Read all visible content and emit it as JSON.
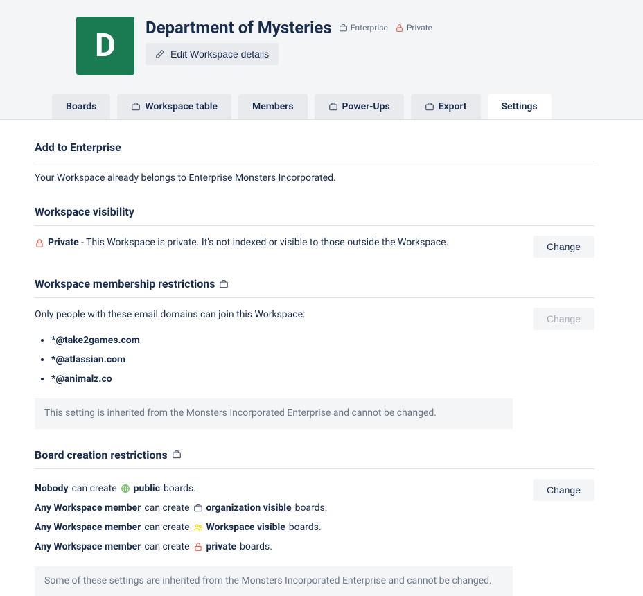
{
  "workspace": {
    "initial": "D",
    "title": "Department of Mysteries",
    "enterprise_badge": "Enterprise",
    "privacy_badge": "Private",
    "edit_label": "Edit Workspace details"
  },
  "tabs": {
    "boards": "Boards",
    "workspace_table": "Workspace table",
    "members": "Members",
    "powerups": "Power-Ups",
    "export": "Export",
    "settings": "Settings"
  },
  "sections": {
    "enterprise": {
      "heading": "Add to Enterprise",
      "text": "Your Workspace already belongs to Enterprise Monsters Incorporated."
    },
    "visibility": {
      "heading": "Workspace visibility",
      "label": "Private",
      "text": " - This Workspace is private. It's not indexed or visible to those outside the Workspace.",
      "change": "Change"
    },
    "membership": {
      "heading": "Workspace membership restrictions",
      "intro": "Only people with these email domains can join this Workspace:",
      "domains": [
        "*@take2games.com",
        "*@atlassian.com",
        "*@animalz.co"
      ],
      "inherited": "This setting is inherited from the Monsters Incorporated Enterprise and cannot be changed.",
      "change": "Change"
    },
    "board_creation": {
      "heading": "Board creation restrictions",
      "change": "Change",
      "rules": [
        {
          "who": "Nobody",
          "verb": " can create ",
          "scope": "public",
          "suffix": " boards.",
          "icon": "globe"
        },
        {
          "who": "Any Workspace member",
          "verb": " can create ",
          "scope": "organization visible",
          "suffix": " boards.",
          "icon": "briefcase"
        },
        {
          "who": "Any Workspace member",
          "verb": " can create ",
          "scope": "Workspace visible",
          "suffix": " boards.",
          "icon": "people"
        },
        {
          "who": "Any Workspace member",
          "verb": " can create ",
          "scope": "private",
          "suffix": " boards.",
          "icon": "lock"
        }
      ],
      "inherited": "Some of these settings are inherited from the Monsters Incorporated Enterprise and cannot be changed."
    }
  }
}
